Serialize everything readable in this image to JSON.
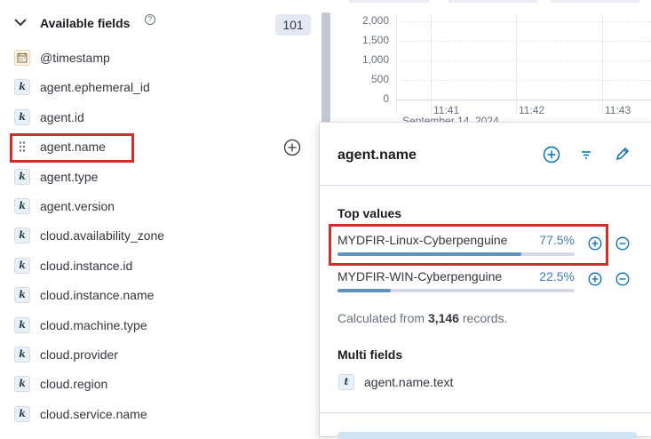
{
  "sidebar": {
    "title": "Available fields",
    "count": "101",
    "fields": [
      {
        "name": "@timestamp",
        "type": "date"
      },
      {
        "name": "agent.ephemeral_id",
        "type": "k"
      },
      {
        "name": "agent.id",
        "type": "k"
      },
      {
        "name": "agent.name",
        "type": "drag"
      },
      {
        "name": "agent.type",
        "type": "k"
      },
      {
        "name": "agent.version",
        "type": "k"
      },
      {
        "name": "cloud.availability_zone",
        "type": "k"
      },
      {
        "name": "cloud.instance.id",
        "type": "k"
      },
      {
        "name": "cloud.instance.name",
        "type": "k"
      },
      {
        "name": "cloud.machine.type",
        "type": "k"
      },
      {
        "name": "cloud.provider",
        "type": "k"
      },
      {
        "name": "cloud.region",
        "type": "k"
      },
      {
        "name": "cloud.service.name",
        "type": "k"
      }
    ],
    "type_letter": "k"
  },
  "histogram": {
    "yticks": [
      "2,000",
      "1,500",
      "1,000",
      "500",
      "0"
    ],
    "xticks": [
      "11:41",
      "11:42",
      "11:43"
    ],
    "date_label": "September 14, 2024"
  },
  "popover": {
    "field_name": "agent.name",
    "top_values_title": "Top values",
    "values": [
      {
        "label": "MYDFIR-Linux-Cyberpenguine",
        "percent": "77.5%",
        "fraction": 0.775
      },
      {
        "label": "MYDFIR-WIN-Cyberpenguine",
        "percent": "22.5%",
        "fraction": 0.225
      }
    ],
    "calc_prefix": "Calculated from ",
    "calc_count": "3,146",
    "calc_suffix": " records.",
    "multi_fields_title": "Multi fields",
    "multi_field": {
      "name": "agent.name.text",
      "type_letter": "t"
    }
  },
  "colors": {
    "accent": "#006bb8",
    "bar": "#6092c0",
    "highlight": "#d62c2c"
  }
}
